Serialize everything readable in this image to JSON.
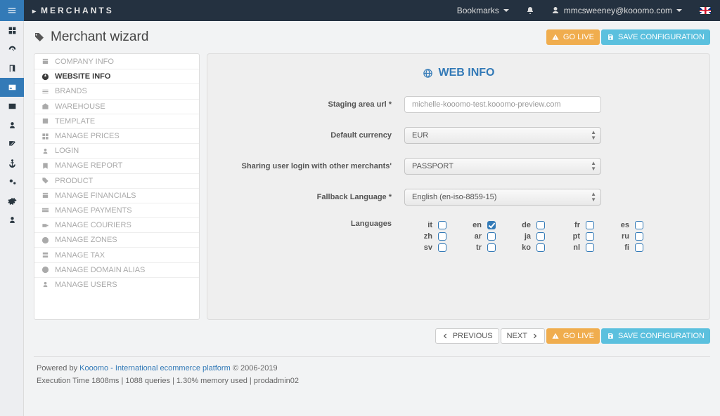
{
  "navbar": {
    "brand": "MERCHANTS",
    "bookmarks": "Bookmarks",
    "user": "mmcsweeney@kooomo.com"
  },
  "page": {
    "title": "Merchant wizard",
    "go_live": "GO LIVE",
    "save_config": "SAVE CONFIGURATION",
    "previous": "PREVIOUS",
    "next": "NEXT"
  },
  "side": {
    "items": [
      "COMPANY INFO",
      "WEBSITE INFO",
      "BRANDS",
      "WAREHOUSE",
      "TEMPLATE",
      "MANAGE PRICES",
      "LOGIN",
      "MANAGE REPORT",
      "PRODUCT",
      "MANAGE FINANCIALS",
      "MANAGE PAYMENTS",
      "MANAGE COURIERS",
      "MANAGE ZONES",
      "MANAGE TAX",
      "MANAGE DOMAIN ALIAS",
      "MANAGE USERS"
    ],
    "active_index": 1
  },
  "web_info": {
    "heading": "WEB INFO",
    "labels": {
      "staging": "Staging area url *",
      "currency": "Default currency",
      "sharing": "Sharing user login with other merchants'",
      "fallback": "Fallback Language *",
      "languages": "Languages"
    },
    "values": {
      "staging": "michelle-kooomo-test.kooomo-preview.com",
      "currency": "EUR",
      "sharing": "PASSPORT",
      "fallback": "English (en-iso-8859-15)"
    },
    "languages": [
      {
        "code": "it",
        "checked": false
      },
      {
        "code": "en",
        "checked": true
      },
      {
        "code": "de",
        "checked": false
      },
      {
        "code": "fr",
        "checked": false
      },
      {
        "code": "es",
        "checked": false
      },
      {
        "code": "zh",
        "checked": false
      },
      {
        "code": "ar",
        "checked": false
      },
      {
        "code": "ja",
        "checked": false
      },
      {
        "code": "pt",
        "checked": false
      },
      {
        "code": "ru",
        "checked": false
      },
      {
        "code": "sv",
        "checked": false
      },
      {
        "code": "tr",
        "checked": false
      },
      {
        "code": "ko",
        "checked": false
      },
      {
        "code": "nl",
        "checked": false
      },
      {
        "code": "fi",
        "checked": false
      }
    ]
  },
  "footer": {
    "powered_prefix": "Powered by ",
    "powered_link": "Kooomo - International ecommerce platform",
    "powered_suffix": " © 2006-2019",
    "exec": "Execution Time 1808ms | 1088 queries | 1.30% memory used | prodadmin02"
  }
}
